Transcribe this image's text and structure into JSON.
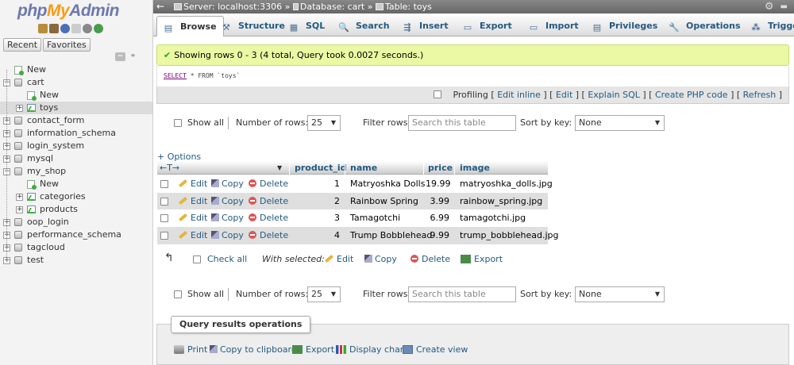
{
  "nav": {
    "logo_php": "php",
    "logo_my": "My",
    "logo_admin": "Admin",
    "tabs": [
      "Recent",
      "Favorites"
    ],
    "tree": [
      {
        "label": "New",
        "kind": "new",
        "level": 0
      },
      {
        "label": "cart",
        "kind": "db",
        "level": 0,
        "expanded": true
      },
      {
        "label": "New",
        "kind": "new",
        "level": 1
      },
      {
        "label": "toys",
        "kind": "table",
        "level": 1,
        "selected": true
      },
      {
        "label": "contact_form",
        "kind": "db",
        "level": 0
      },
      {
        "label": "information_schema",
        "kind": "db",
        "level": 0
      },
      {
        "label": "login_system",
        "kind": "db",
        "level": 0
      },
      {
        "label": "mysql",
        "kind": "db",
        "level": 0
      },
      {
        "label": "my_shop",
        "kind": "db",
        "level": 0,
        "expanded": true
      },
      {
        "label": "New",
        "kind": "new",
        "level": 1
      },
      {
        "label": "categories",
        "kind": "table",
        "level": 1
      },
      {
        "label": "products",
        "kind": "table",
        "level": 1
      },
      {
        "label": "oop_login",
        "kind": "db",
        "level": 0
      },
      {
        "label": "performance_schema",
        "kind": "db",
        "level": 0
      },
      {
        "label": "tagcloud",
        "kind": "db",
        "level": 0
      },
      {
        "label": "test",
        "kind": "db",
        "level": 0
      }
    ]
  },
  "topbar": {
    "server": "Server: localhost:3306",
    "database": "Database: cart",
    "table": "Table: toys",
    "sep": "»"
  },
  "tabs": [
    {
      "label": "Browse",
      "icon": "browse-icon",
      "glyph": "▤",
      "active": true
    },
    {
      "label": "Structure",
      "icon": "structure-icon",
      "glyph": "⚒"
    },
    {
      "label": "SQL",
      "icon": "sql-icon",
      "glyph": "▦"
    },
    {
      "label": "Search",
      "icon": "search-icon",
      "glyph": "🔍"
    },
    {
      "label": "Insert",
      "icon": "insert-icon",
      "glyph": "⇶"
    },
    {
      "label": "Export",
      "icon": "export-icon",
      "glyph": "▭"
    },
    {
      "label": "Import",
      "icon": "import-icon",
      "glyph": "▭"
    },
    {
      "label": "Privileges",
      "icon": "privileges-icon",
      "glyph": "▤"
    },
    {
      "label": "Operations",
      "icon": "operations-icon",
      "glyph": "🔧"
    },
    {
      "label": "Triggers",
      "icon": "triggers-icon",
      "glyph": "⁂"
    }
  ],
  "message": "Showing rows 0 - 3 (4 total, Query took 0.0027 seconds.)",
  "sql": {
    "keyword": "SELECT",
    "rest": " * FROM ",
    "table": "`toys`"
  },
  "profiling": {
    "label": "Profiling",
    "links": [
      "Edit inline",
      "Edit",
      "Explain SQL",
      "Create PHP code",
      "Refresh"
    ]
  },
  "controls": {
    "show_all": "Show all",
    "rows_label": "Number of rows:",
    "rows_value": "25",
    "filter_label": "Filter rows:",
    "filter_placeholder": "Search this table",
    "sort_label": "Sort by key:",
    "sort_value": "None"
  },
  "options_link": "+ Options",
  "table": {
    "columns": [
      "product_id",
      "name",
      "price",
      "image"
    ],
    "actions": {
      "edit": "Edit",
      "copy": "Copy",
      "delete": "Delete"
    },
    "rows": [
      {
        "product_id": "1",
        "name": "Matryoshka Dolls",
        "price": "19.99",
        "image": "matryoshka_dolls.jpg"
      },
      {
        "product_id": "2",
        "name": "Rainbow Spring",
        "price": "3.99",
        "image": "rainbow_spring.jpg"
      },
      {
        "product_id": "3",
        "name": "Tamagotchi",
        "price": "6.99",
        "image": "tamagotchi.jpg"
      },
      {
        "product_id": "4",
        "name": "Trump Bobblehead",
        "price": "9.99",
        "image": "trump_bobblehead.jpg"
      }
    ]
  },
  "with_selected": {
    "check_all": "Check all",
    "label": "With selected:",
    "edit": "Edit",
    "copy": "Copy",
    "delete": "Delete",
    "export": "Export"
  },
  "query_results": {
    "title": "Query results operations",
    "print": "Print",
    "copy_clipboard": "Copy to clipboard",
    "export": "Export",
    "display_chart": "Display chart",
    "create_view": "Create view"
  }
}
